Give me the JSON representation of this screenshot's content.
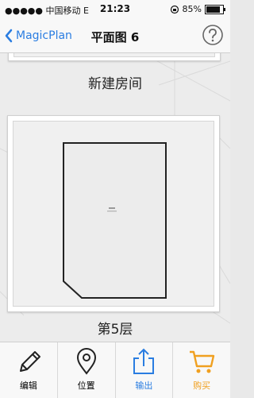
{
  "status_bar": {
    "carrier": "●●●●● 中国移动  E",
    "time": "21:23",
    "battery_percent": "85%",
    "battery_level": 0.85
  },
  "nav": {
    "back_label": "MagicPlan",
    "title": "平面图 6"
  },
  "cards": {
    "top_label": "新建房间",
    "floor_label": "第5层"
  },
  "tabbar": {
    "items": [
      {
        "label": "编辑",
        "icon": "pencil-icon",
        "color": "#222222"
      },
      {
        "label": "位置",
        "icon": "location-pin-icon",
        "color": "#222222"
      },
      {
        "label": "输出",
        "icon": "share-icon",
        "color": "#2a7de1"
      },
      {
        "label": "购买",
        "icon": "cart-icon",
        "color": "#f0a020"
      }
    ]
  },
  "colors": {
    "accent": "#2a7de1",
    "buy": "#f0a020"
  }
}
